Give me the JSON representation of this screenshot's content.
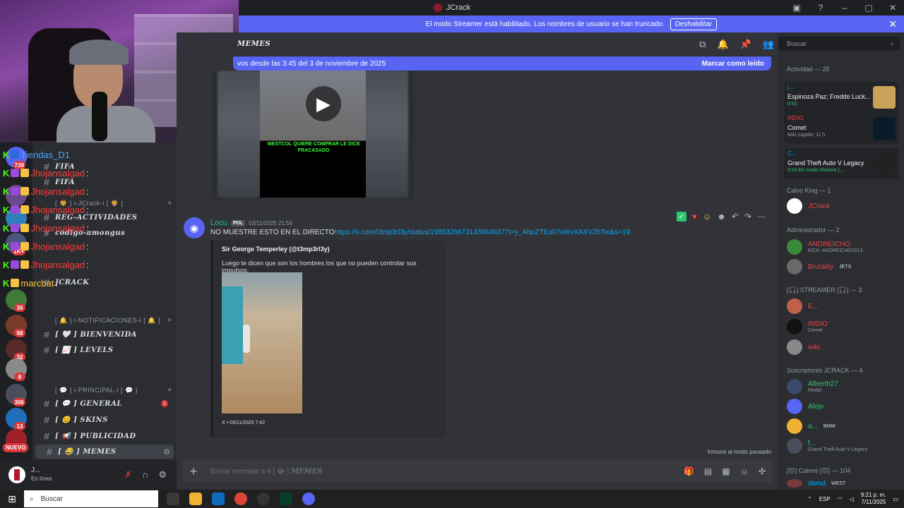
{
  "window": {
    "title": "JCrack"
  },
  "banner": {
    "text": "El modo Streamer está habilitado. Los nombres de usuario se han truncado.",
    "button": "Deshabilitar"
  },
  "server_badges": [
    "739",
    "1K+",
    "36",
    "98",
    "32",
    "8",
    "306",
    "13"
  ],
  "server_new_label": "NUEVO",
  "channels": [
    {
      "type": "channel",
      "name": "FIFA"
    },
    {
      "type": "channel",
      "name": "FIFA"
    },
    {
      "type": "category",
      "name": "[ 🦁 ] i-JCrack-i [ 🦁 ]"
    },
    {
      "type": "channel",
      "name": "REG-ACTIVIDADES"
    },
    {
      "type": "channel",
      "name": "codigo-amongus"
    },
    {
      "type": "channel",
      "name": "JCRACK"
    },
    {
      "type": "category",
      "name": "[ 🔔 ] i-NOTIFICACIONES-i [ 🔔 ]"
    },
    {
      "type": "channel",
      "name": "[ 🤍 ] BIENVENIDA"
    },
    {
      "type": "channel",
      "name": "[ 📈 ] LEVELS"
    },
    {
      "type": "category",
      "name": "[ 💬 ] i-PRINCIPAL-i [ 💬 ]"
    },
    {
      "type": "channel",
      "name": "[ 💬 ] GENERAL",
      "unread": "1"
    },
    {
      "type": "channel",
      "name": "[ 😊 ] SKINS"
    },
    {
      "type": "channel",
      "name": "[ 📢 ] PUBLICIDAD"
    },
    {
      "type": "channel",
      "name": "[ 😂 ] MEMES"
    }
  ],
  "overlay_chat": [
    {
      "user": "Tiendas_D1",
      "color": "blue"
    },
    {
      "user": "Jhojansalgad",
      "color": "red"
    },
    {
      "user": "Jhojansalgad",
      "color": "red"
    },
    {
      "user": "Jhojansalgad",
      "color": "red"
    },
    {
      "user": "Jhojansalgad",
      "color": "red"
    },
    {
      "user": "Jhojansalgad",
      "color": "red"
    },
    {
      "user": "Jhojansalgad",
      "color": "red"
    },
    {
      "user": "marcbat",
      "color": "yellow"
    }
  ],
  "user_panel": {
    "name": "J...",
    "status": "En línea"
  },
  "chat": {
    "channel_name": "MEMES",
    "new_messages_bar": "vos desde las 3:45 del 3 de noviembre de 2025",
    "mark_read": "Marcar como leído",
    "video_caption": "WESTCOL QUIERE COMPRAR LE DICE FRACASADO",
    "message": {
      "author": "Locu",
      "tag": "POL",
      "time": "03/11/2025 21:59",
      "text": "NO MUESTRE ESTO EN EL DIRECTO",
      "link": "https://x.com/t3mp3rl3y/status/1985326673143664937?t=y_AhpZTEa07sWvXAXVZhTw&s=19"
    },
    "embed": {
      "author": "Sir George Temperley (@t3mp3rl3y)",
      "text": "Luego te dicen que son los hombres los que no pueden controlar sus impulsos.",
      "footer": "X • 03/11/2025 7:42"
    },
    "immune_label": "Inmune al modo pausado",
    "composer_placeholder": "Enviar mensaje a # [ 😂 ]",
    "composer_channel": "MEMES"
  },
  "members": {
    "search_placeholder": "Buscar",
    "activity_header": "Actividad — 25",
    "activities": [
      {
        "who": "j...",
        "title": "Espinoza Paz; Freddo Luck...",
        "sub": "0:52"
      },
      {
        "who": "INDIO",
        "title": "Comet",
        "sub": "Más jugado: 11 h"
      },
      {
        "who": "C...",
        "title": "Grand Theft Auto V Legacy",
        "sub": "0:04  En modo Historia (..."
      }
    ],
    "groups": [
      {
        "title": "Calvo King — 1",
        "members": [
          {
            "name": "JCrack",
            "sub": ""
          }
        ]
      },
      {
        "title": "Administrador — 2",
        "members": [
          {
            "name": "ANDREICHO",
            "sub": "KICK: ANDREICHO1013"
          },
          {
            "name": "Brutality",
            "sub": "JETS"
          }
        ]
      },
      {
        "title": "[🎧] STREAMER [🎧] — 3",
        "members": [
          {
            "name": "E...",
            "sub": ""
          },
          {
            "name": "INDIO",
            "sub": "Comet"
          },
          {
            "name": "wiki.",
            "sub": ""
          }
        ]
      },
      {
        "title": "Suscriptores JCRACK — 4",
        "members": [
          {
            "name": "Alberth27",
            "sub": "Medal"
          },
          {
            "name": "Alejo",
            "sub": ""
          },
          {
            "name": "a...",
            "sub": "BMW"
          },
          {
            "name": "f...",
            "sub": "Grand Theft Auto V Legacy"
          }
        ]
      },
      {
        "title": "[😊] Calvos [😊] — 104",
        "members": [
          {
            "name": "damd",
            "sub": "WEST"
          }
        ]
      }
    ]
  },
  "taskbar": {
    "search": "Buscar",
    "lang": "ESP",
    "time": "9:21 p. m.",
    "date": "7/11/2025"
  }
}
